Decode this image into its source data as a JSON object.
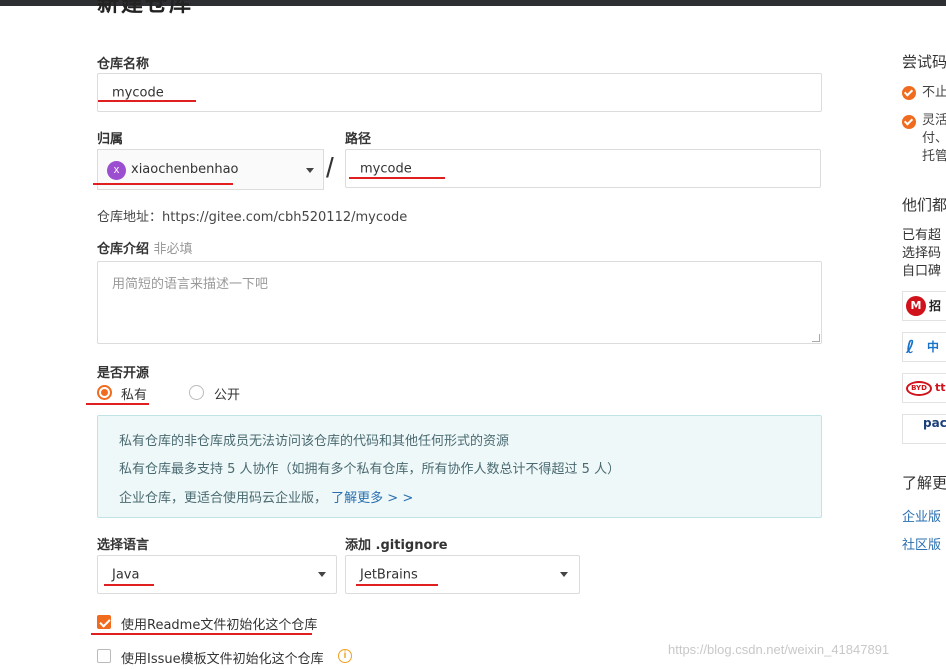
{
  "page_title": "新建仓库",
  "repo_name": {
    "label": "仓库名称",
    "value": "mycode"
  },
  "owner": {
    "label": "归属",
    "avatar_letter": "x",
    "value": "xiaochenbenhao"
  },
  "path": {
    "label": "路径",
    "value": "mycode"
  },
  "separator": "/",
  "repo_address": {
    "label": "仓库地址：",
    "value": "https://gitee.com/cbh520112/mycode"
  },
  "description": {
    "label": "仓库介绍",
    "optional": "非必填",
    "placeholder": "用简短的语言来描述一下吧"
  },
  "visibility": {
    "label": "是否开源",
    "options": [
      {
        "label": "私有",
        "checked": true
      },
      {
        "label": "公开",
        "checked": false
      }
    ]
  },
  "info_box": {
    "line1": "私有仓库的非仓库成员无法访问该仓库的代码和其他任何形式的资源",
    "line2": "私有仓库最多支持 5 人协作（如拥有多个私有仓库，所有协作人数总计不得超过 5 人）",
    "line3_text": "企业仓库，更适合使用码云企业版，",
    "line3_link": "了解更多 > >"
  },
  "language": {
    "label": "选择语言",
    "value": "Java"
  },
  "gitignore": {
    "label": "添加 .gitignore",
    "value": "JetBrains"
  },
  "init_readme": {
    "label": "使用Readme文件初始化这个仓库",
    "checked": true
  },
  "init_issue": {
    "label": "使用Issue模板文件初始化这个仓库",
    "checked": false
  },
  "sidebar": {
    "title1": "尝试码",
    "item1": "不止",
    "item2_lines": [
      "灵活",
      "付、",
      "托管"
    ],
    "title2": "他们都",
    "para_lines": [
      "已有超",
      "选择码",
      "自口碑"
    ],
    "logos": [
      "招",
      "中",
      "tt",
      "pac 文 思"
    ],
    "title3": "了解更",
    "link1": "企业版",
    "link2": "社区版"
  },
  "watermark": "https://blog.csdn.net/weixin_41847891",
  "colors": {
    "accent": "#f06b1e",
    "annotation": "#e02020",
    "link": "#2a6fb0"
  }
}
